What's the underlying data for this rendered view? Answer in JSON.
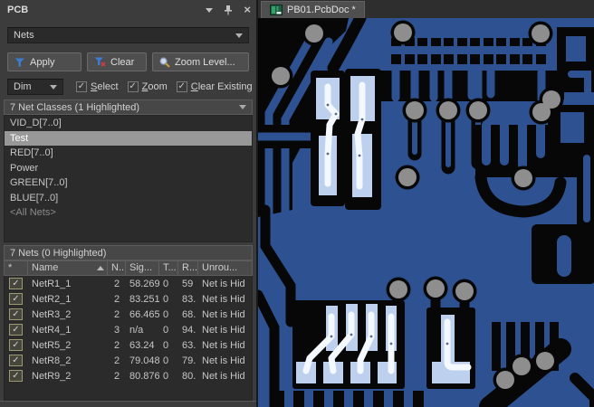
{
  "panel": {
    "title": "PCB",
    "mode_select": {
      "value": "Nets"
    },
    "toolbar": {
      "apply": "Apply",
      "clear": "Clear",
      "zoom_level": "Zoom Level..."
    },
    "options": {
      "dim": "Dim",
      "checkboxes": [
        {
          "label": "Select",
          "check": "✓",
          "checked": true
        },
        {
          "label": "Zoom",
          "check": "✓",
          "checked": true
        },
        {
          "label": "Clear Existing",
          "check": "✓",
          "checked": true
        }
      ]
    },
    "net_classes": {
      "header": "7 Net Classes (1 Highlighted)",
      "items": [
        {
          "label": "VID_D[7..0]"
        },
        {
          "label": "Test",
          "selected": true
        },
        {
          "label": "RED[7..0]"
        },
        {
          "label": "Power"
        },
        {
          "label": "GREEN[7..0]"
        },
        {
          "label": "BLUE[7..0]"
        },
        {
          "label": "<All Nets>",
          "muted": true
        }
      ]
    },
    "nets": {
      "header": "7 Nets (0 Highlighted)",
      "columns": [
        "*",
        "Name",
        "N..",
        "Sig...",
        "T...",
        "R...",
        "Unrou..."
      ],
      "rows": [
        {
          "check": "✓",
          "checked": true,
          "name": "NetR1_1",
          "nodes": "2",
          "signal": "58.269",
          "t": "0",
          "routed": "59",
          "unrouted": "Net is Hid"
        },
        {
          "check": "✓",
          "checked": true,
          "name": "NetR2_1",
          "nodes": "2",
          "signal": "83.251",
          "t": "0",
          "routed": "83.",
          "unrouted": "Net is Hid"
        },
        {
          "check": "✓",
          "checked": true,
          "name": "NetR3_2",
          "nodes": "2",
          "signal": "66.465",
          "t": "0",
          "routed": "68.",
          "unrouted": "Net is Hid"
        },
        {
          "check": "✓",
          "checked": true,
          "name": "NetR4_1",
          "nodes": "3",
          "signal": "n/a",
          "t": "0",
          "routed": "94.",
          "unrouted": "Net is Hid"
        },
        {
          "check": "✓",
          "checked": true,
          "name": "NetR5_2",
          "nodes": "2",
          "signal": "63.24",
          "t": "0",
          "routed": "63.",
          "unrouted": "Net is Hid"
        },
        {
          "check": "✓",
          "checked": true,
          "name": "NetR8_2",
          "nodes": "2",
          "signal": "79.048",
          "t": "0",
          "routed": "79.",
          "unrouted": "Net is Hid"
        },
        {
          "check": "✓",
          "checked": true,
          "name": "NetR9_2",
          "nodes": "2",
          "signal": "80.876",
          "t": "0",
          "routed": "80.",
          "unrouted": "Net is Hid"
        }
      ]
    }
  },
  "document": {
    "tab": "PB01.PcbDoc *"
  },
  "colors": {
    "board_copper_blue": "#2e5291",
    "board_clearance_black": "#070707",
    "via_gray": "#8e8e8e",
    "highlight_pad": "#bdd1ee",
    "highlight_trace": "#f4f8ff",
    "panel_bg": "#3c3c3c",
    "list_bg": "#2b2b2b",
    "selection_gray": "#989898",
    "funnel_blue": "#3d7ad1",
    "clear_red": "#d03c3c",
    "magnifier_handle_yellow": "#c79a3d",
    "doc_icon_green": "#34a06a"
  }
}
